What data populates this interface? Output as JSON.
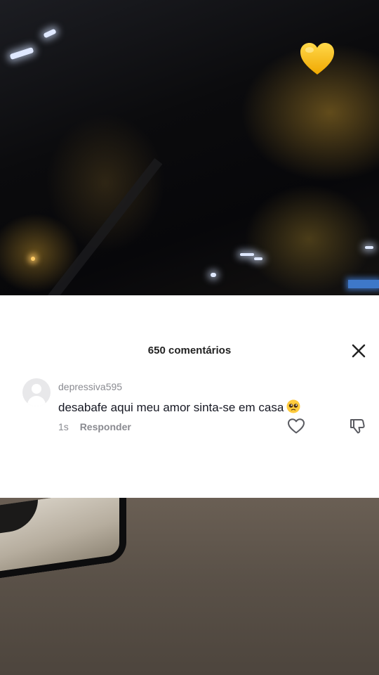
{
  "video": {
    "overlay_icon": "yellow-heart-icon",
    "heart_color": "#f7c21c"
  },
  "comments": {
    "title": "650 comentários",
    "close_icon": "close-icon",
    "items": [
      {
        "username": "depressiva595",
        "text": "desabafe aqui meu amor sinta-se em casa",
        "emoji": "pleading-face-emoji",
        "time": "1s",
        "reply_label": "Responder",
        "like_icon": "heart-outline-icon",
        "dislike_icon": "thumbs-down-icon"
      }
    ]
  }
}
